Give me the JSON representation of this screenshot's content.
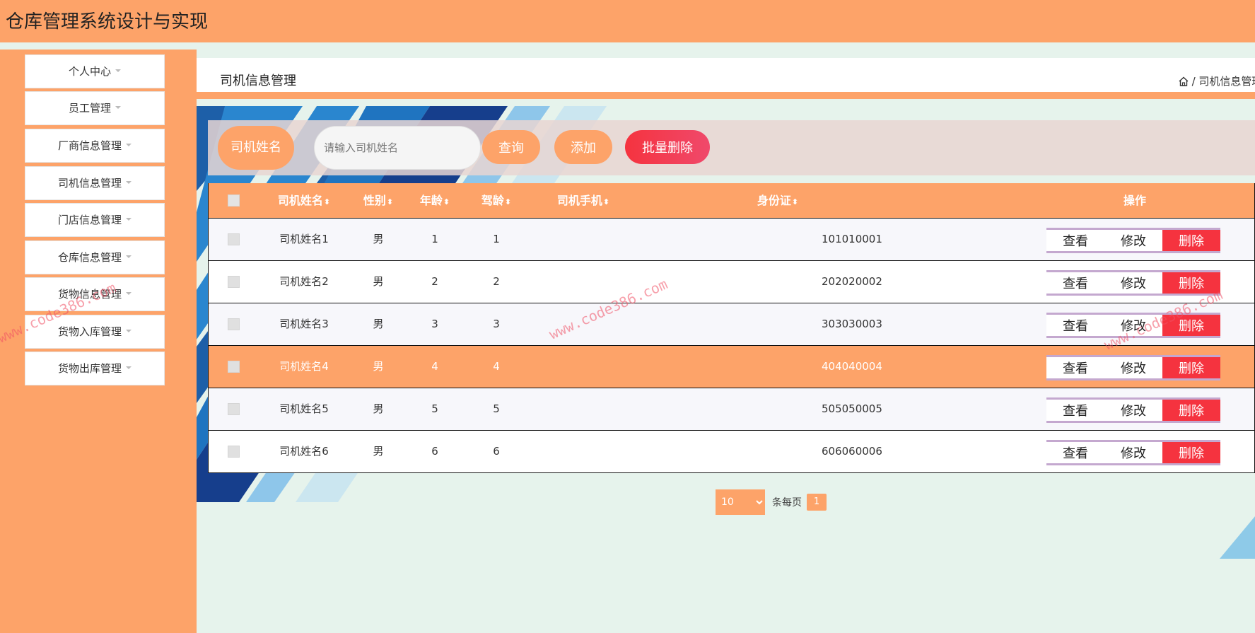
{
  "app": {
    "title": "仓库管理系统设计与实现"
  },
  "sidebar": {
    "items": [
      {
        "label": "个人中心"
      },
      {
        "label": "员工管理"
      },
      {
        "label": "厂商信息管理"
      },
      {
        "label": "司机信息管理"
      },
      {
        "label": "门店信息管理"
      },
      {
        "label": "仓库信息管理"
      },
      {
        "label": "货物信息管理"
      },
      {
        "label": "货物入库管理"
      },
      {
        "label": "货物出库管理"
      }
    ]
  },
  "header": {
    "title": "司机信息管理",
    "breadcrumb": "/ 司机信息管理 / 司"
  },
  "search": {
    "label": "司机姓名",
    "placeholder": "请输入司机姓名",
    "query_label": "查询",
    "add_label": "添加",
    "batch_delete_label": "批量删除"
  },
  "table": {
    "columns": [
      "司机姓名",
      "性别",
      "年龄",
      "驾龄",
      "司机手机",
      "身份证",
      "操作"
    ],
    "sort_icon": "⬍",
    "rows": [
      {
        "name": "司机姓名1",
        "gender": "男",
        "age": "1",
        "years": "1",
        "phone": "",
        "id_card": "101010001"
      },
      {
        "name": "司机姓名2",
        "gender": "男",
        "age": "2",
        "years": "2",
        "phone": "",
        "id_card": "202020002"
      },
      {
        "name": "司机姓名3",
        "gender": "男",
        "age": "3",
        "years": "3",
        "phone": "",
        "id_card": "303030003"
      },
      {
        "name": "司机姓名4",
        "gender": "男",
        "age": "4",
        "years": "4",
        "phone": "",
        "id_card": "404040004"
      },
      {
        "name": "司机姓名5",
        "gender": "男",
        "age": "5",
        "years": "5",
        "phone": "",
        "id_card": "505050005"
      },
      {
        "name": "司机姓名6",
        "gender": "男",
        "age": "6",
        "years": "6",
        "phone": "",
        "id_card": "606060006"
      }
    ],
    "actions": {
      "view": "查看",
      "edit": "修改",
      "delete": "删除"
    }
  },
  "pagination": {
    "page_size": "10",
    "per_page_label": "条每页",
    "current_page": "1"
  },
  "watermark": "www.code386.com",
  "colors": {
    "primary": "#fda369",
    "background": "#e6f3ec",
    "danger": "#f5333f",
    "highlight_row": "#fda369"
  }
}
